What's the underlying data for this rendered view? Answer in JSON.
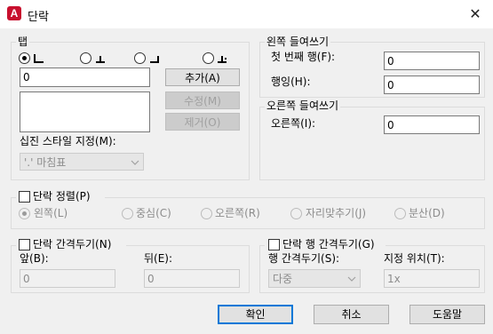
{
  "window": {
    "title": "단락",
    "icon": "autocad-icon",
    "close_glyph": "✕"
  },
  "tabs": {
    "legend": "탭",
    "value": "0",
    "add_label": "추가(A)",
    "modify_label": "수정(M)",
    "remove_label": "제거(O)",
    "decimal_style_label": "십진 스타일 지정(M):",
    "decimal_style_value": "'.' 마침표",
    "alignment_selected": 0
  },
  "left_indent": {
    "legend": "왼쪽 들여쓰기",
    "first_line_label": "첫 번째 행(F):",
    "first_line_value": "0",
    "hanging_label": "행잉(H):",
    "hanging_value": "0"
  },
  "right_indent": {
    "legend": "오른쪽 들여쓰기",
    "right_label": "오른쪽(I):",
    "right_value": "0"
  },
  "alignment": {
    "label": "단락 정렬(P)",
    "checked": false,
    "options": [
      "왼쪽(L)",
      "중심(C)",
      "오른쪽(R)",
      "자리맞추기(J)",
      "분산(D)"
    ],
    "selected": 0
  },
  "spacing": {
    "label": "단락 간격두기(N)",
    "checked": false,
    "before_label": "앞(B):",
    "before_value": "0",
    "after_label": "뒤(E):",
    "after_value": "0"
  },
  "line_spacing": {
    "label": "단락 행 간격두기(G)",
    "checked": false,
    "spacing_label": "행 간격두기(S):",
    "spacing_value": "다중",
    "at_label": "지정 위치(T):",
    "at_value": "1x"
  },
  "buttons": {
    "ok": "확인",
    "cancel": "취소",
    "help": "도움말"
  }
}
